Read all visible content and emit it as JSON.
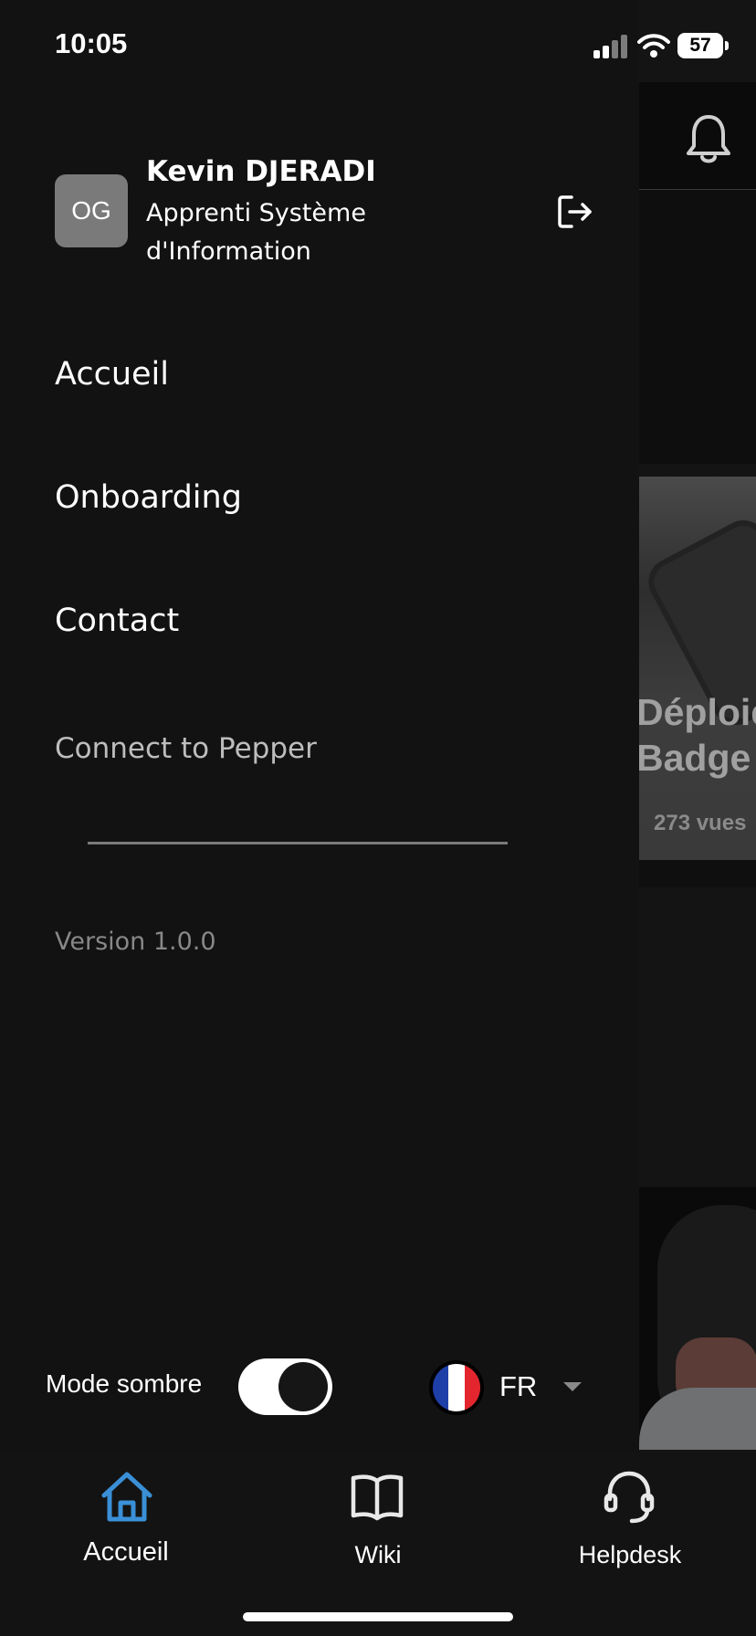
{
  "status_bar": {
    "time": "10:05",
    "battery": "57",
    "icons": [
      "signal-icon",
      "wifi-icon",
      "battery-icon"
    ]
  },
  "background": {
    "card_title": "Déploie\nBadge",
    "card_views": "273 vues",
    "icons": [
      "bell-icon"
    ]
  },
  "drawer": {
    "avatar_initials": "OG",
    "user_name": "Kevin DJERADI",
    "user_role": "Apprenti Système d'Information",
    "menu": {
      "accueil": "Accueil",
      "onboarding": "Onboarding",
      "contact": "Contact",
      "pepper": "Connect to Pepper"
    },
    "version": "Version 1.0.0",
    "dark_mode_label": "Mode sombre",
    "dark_mode_on": true,
    "language": "FR"
  },
  "tabbar": {
    "home": "Accueil",
    "wiki": "Wiki",
    "helpdesk": "Helpdesk",
    "active": "home",
    "active_color": "#3a8fd6"
  }
}
